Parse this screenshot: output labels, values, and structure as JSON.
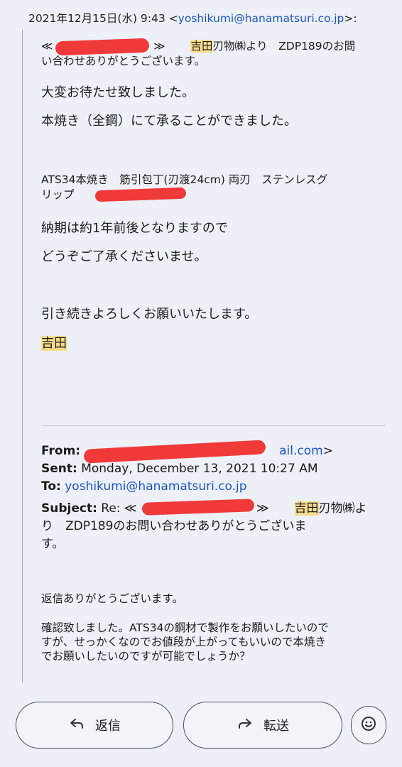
{
  "header": {
    "date_prefix": "2021年12月15日(水) 9:43 <",
    "email": "yoshikumi@hanamatsuri.co.jp",
    "date_suffix": ">:"
  },
  "quoted": {
    "line1_open": "≪",
    "line1_close": "≫",
    "shop_name": "吉田",
    "line1_rest": "刃物㈱より　ZDP189のお問",
    "line2": "い合わせありがとうございます。",
    "p1": "大変お待たせ致しました。",
    "p2": "本焼き（全鋼）にて承ることができました。",
    "product_line1": "ATS34本焼き　筋引包丁(刃渡24cm) 両刃　ステンレスグ",
    "product_line2": "リップ",
    "p3": "納期は約1年前後となりますので",
    "p4": "どうぞご了承くださいませ。",
    "p5": "引き続きよろしくお願いいたします。",
    "signature": "吉田"
  },
  "original": {
    "from_label": "From:",
    "from_suffix": "ail.com",
    "from_close": ">",
    "sent_label": "Sent:",
    "sent_value": "Monday, December 13, 2021 10:27 AM",
    "to_label": "To:",
    "to_value": "yoshikumi@hanamatsuri.co.jp",
    "subject_label": "Subject:",
    "subject_prefix": "Re: ≪",
    "subject_close": "≫",
    "subject_shop": "吉田",
    "subject_rest1": "刃物㈱よ",
    "subject_line2": "り　ZDP189のお問い合わせありがとうございま",
    "subject_line3": "す。",
    "body1": "返信ありがとうございます。",
    "body2_line1": "確認致しました。ATS34の鋼材で製作をお願いしたいので",
    "body2_line2": "すが、せっかくなのでお値段が上がってもいいので本焼き",
    "body2_line3": "でお願いしたいのですが可能でしょうか？"
  },
  "actions": {
    "reply_label": "返信",
    "forward_label": "転送"
  },
  "colors": {
    "background": "#eef0f7",
    "link": "#1a56c8",
    "highlight": "#f7dc8c",
    "redaction": "#f03a3a"
  }
}
